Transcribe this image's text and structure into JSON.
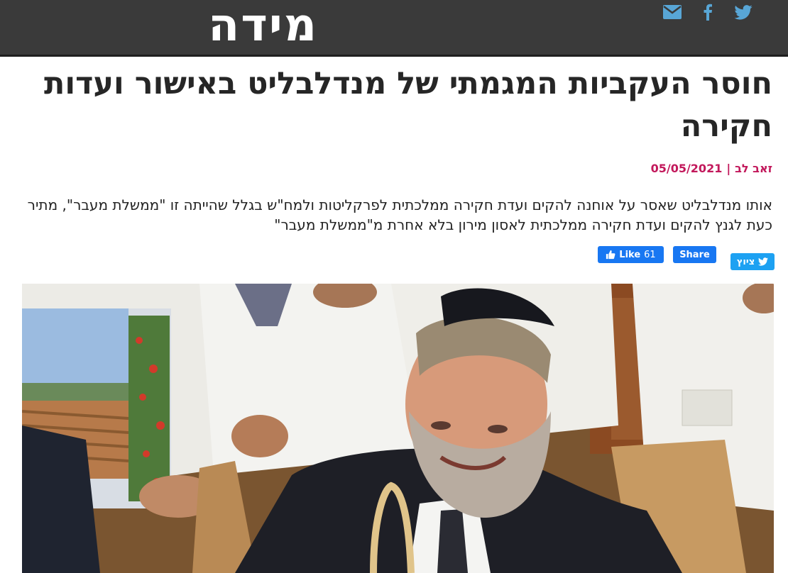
{
  "header": {
    "logo_text": "מידה",
    "bg_color": "#3a3a3a",
    "icons": [
      "email-icon",
      "facebook-icon",
      "twitter-icon"
    ],
    "icon_color": "#58a6d6"
  },
  "article": {
    "title": "חוסר העקביות המגמתי של מנדלבליט באישור ועדות חקירה",
    "author": "זאב לב",
    "separator": "|",
    "date": "05/05/2021",
    "summary": "אותו מנדלבליט שאסר על אוחנה להקים ועדת חקירה ממלכתית לפרקליטות ולמח\"ש בגלל שהייתה זו \"ממשלת מעבר\", מתיר כעת לגנץ להקים ועדת חקירה ממלכתית לאסון מירון בלא אחרת מ\"ממשלת מעבר\""
  },
  "share": {
    "like_label": "Like",
    "like_count": "61",
    "share_label": "Share",
    "tweet_label": "ציוץ"
  },
  "colors": {
    "accent": "#c2185b",
    "facebook": "#1877f2",
    "twitter": "#1da1f2"
  }
}
